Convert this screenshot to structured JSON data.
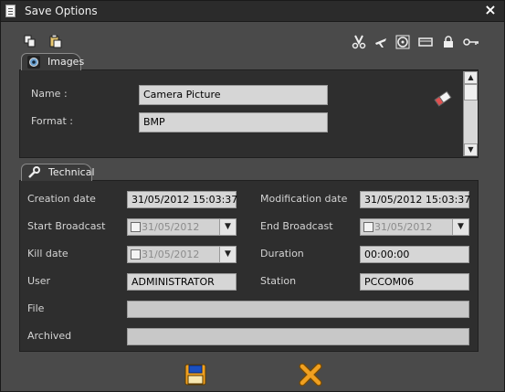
{
  "window": {
    "title": "Save Options",
    "close_glyph": "×"
  },
  "toolbar": {
    "left_icons": [
      "copy-icon",
      "paste-icon"
    ],
    "right_icons": [
      "scissors-icon",
      "airplane-icon",
      "disc-icon",
      "card-icon",
      "lock-icon",
      "key-icon"
    ]
  },
  "images_tab": {
    "label": "Images",
    "name_label": "Name :",
    "name_value": "Camera Picture",
    "format_label": "Format :",
    "format_value": "BMP"
  },
  "technical_tab": {
    "label": "Technical",
    "creation_date_label": "Creation date",
    "creation_date_value": "31/05/2012 15:03:37",
    "modification_date_label": "Modification date",
    "modification_date_value": "31/05/2012 15:03:37",
    "start_broadcast_label": "Start Broadcast",
    "start_broadcast_value": "31/05/2012",
    "end_broadcast_label": "End Broadcast",
    "end_broadcast_value": "31/05/2012",
    "kill_date_label": "Kill date",
    "kill_date_value": "31/05/2012",
    "duration_label": "Duration",
    "duration_value": "00:00:00",
    "user_label": "User",
    "user_value": "ADMINISTRATOR",
    "station_label": "Station",
    "station_value": "PCCOM06",
    "file_label": "File",
    "file_value": "",
    "archived_label": "Archived",
    "archived_value": ""
  },
  "colors": {
    "accent_orange": "#f0a020",
    "save_blue": "#1a4fc0"
  }
}
